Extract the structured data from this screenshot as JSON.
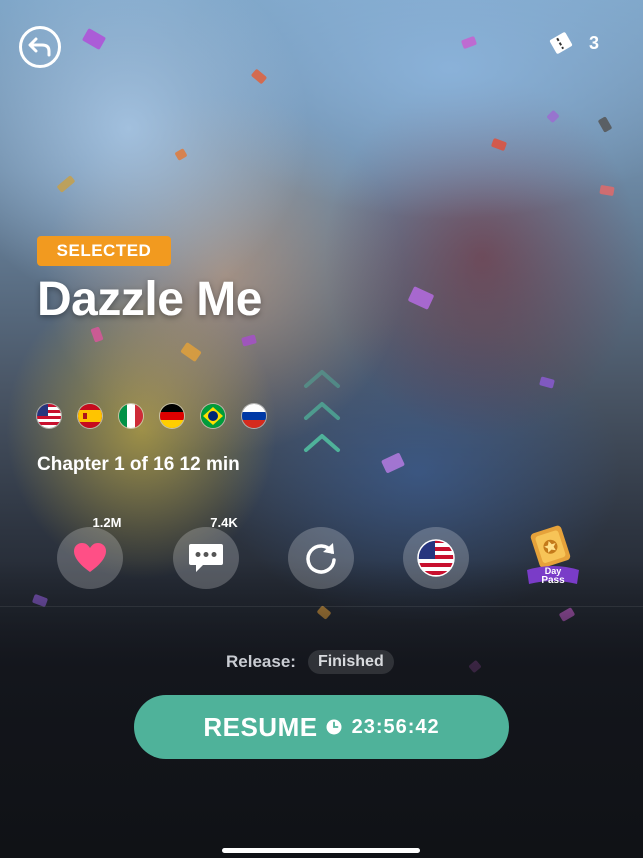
{
  "header": {
    "back_icon": "back-arrow-icon",
    "ticket_icon": "ticket-icon",
    "ticket_count": "3"
  },
  "story": {
    "badge": "SELECTED",
    "title": "Dazzle Me",
    "languages": [
      "us-flag-icon",
      "spain-flag-icon",
      "italy-flag-icon",
      "germany-flag-icon",
      "brazil-flag-icon",
      "russia-flag-icon"
    ],
    "chapter_info": "Chapter 1 of 16  12 min"
  },
  "actions": {
    "likes_count": "1.2M",
    "comments_count": "7.4K",
    "like_icon": "heart-icon",
    "comment_icon": "comment-icon",
    "restart_icon": "restart-icon",
    "language_icon": "us-flag-icon",
    "day_pass_label": "Day Pass"
  },
  "release": {
    "label": "Release:",
    "value": "Finished"
  },
  "resume": {
    "label": "RESUME",
    "timer": "23:56:42",
    "clock_icon": "clock-icon"
  },
  "colors": {
    "badge": "#f29a1f",
    "resume": "#4fb29a",
    "heart": "#ff4f86"
  }
}
